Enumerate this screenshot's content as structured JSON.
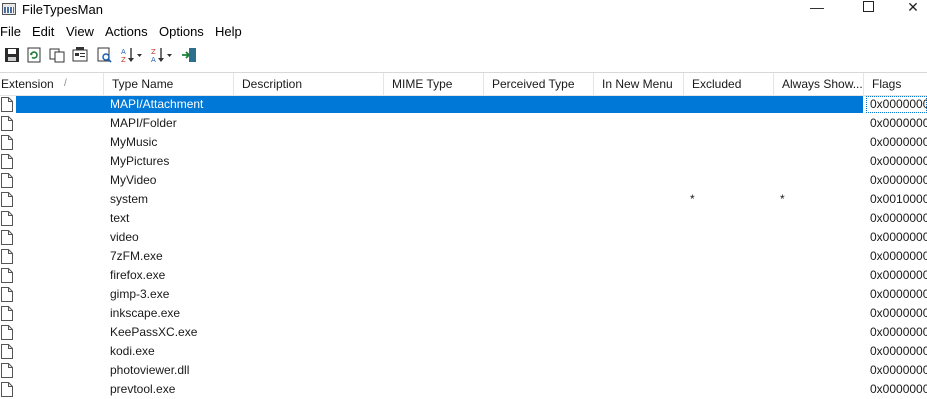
{
  "window": {
    "title": "FileTypesMan"
  },
  "menu": [
    "File",
    "Edit",
    "View",
    "Actions",
    "Options",
    "Help"
  ],
  "toolbar": {
    "icons": [
      "save-icon",
      "refresh-icon",
      "copy-icon",
      "properties-icon",
      "find-icon",
      "sort-ascending-icon",
      "sort-descending-icon",
      "exit-icon"
    ]
  },
  "columns": [
    "Extension",
    "Type Name",
    "Description",
    "MIME Type",
    "Perceived Type",
    "In New Menu",
    "Excluded",
    "Always Show...",
    "Flags"
  ],
  "sort_indicator": "/",
  "rows": [
    {
      "type_name": "MAPI/Attachment",
      "excluded": "",
      "always_show": "",
      "flags": "0x0000000"
    },
    {
      "type_name": "MAPI/Folder",
      "excluded": "",
      "always_show": "",
      "flags": "0x0000000"
    },
    {
      "type_name": "MyMusic",
      "excluded": "",
      "always_show": "",
      "flags": "0x0000000"
    },
    {
      "type_name": "MyPictures",
      "excluded": "",
      "always_show": "",
      "flags": "0x0000000"
    },
    {
      "type_name": "MyVideo",
      "excluded": "",
      "always_show": "",
      "flags": "0x0000000"
    },
    {
      "type_name": "system",
      "excluded": "*",
      "always_show": "*",
      "flags": "0x0010000"
    },
    {
      "type_name": "text",
      "excluded": "",
      "always_show": "",
      "flags": "0x0000000"
    },
    {
      "type_name": "video",
      "excluded": "",
      "always_show": "",
      "flags": "0x0000000"
    },
    {
      "type_name": "7zFM.exe",
      "excluded": "",
      "always_show": "",
      "flags": "0x0000000"
    },
    {
      "type_name": "firefox.exe",
      "excluded": "",
      "always_show": "",
      "flags": "0x0000000"
    },
    {
      "type_name": "gimp-3.exe",
      "excluded": "",
      "always_show": "",
      "flags": "0x0000000"
    },
    {
      "type_name": "inkscape.exe",
      "excluded": "",
      "always_show": "",
      "flags": "0x0000000"
    },
    {
      "type_name": "KeePassXC.exe",
      "excluded": "",
      "always_show": "",
      "flags": "0x0000000"
    },
    {
      "type_name": "kodi.exe",
      "excluded": "",
      "always_show": "",
      "flags": "0x0000000"
    },
    {
      "type_name": "photoviewer.dll",
      "excluded": "",
      "always_show": "",
      "flags": "0x0000000"
    },
    {
      "type_name": "prevtool.exe",
      "excluded": "",
      "always_show": "",
      "flags": "0x0000000"
    }
  ],
  "selected_row": 0,
  "colors": {
    "selection": "#0078d7",
    "grid": "#e5e5e5"
  }
}
